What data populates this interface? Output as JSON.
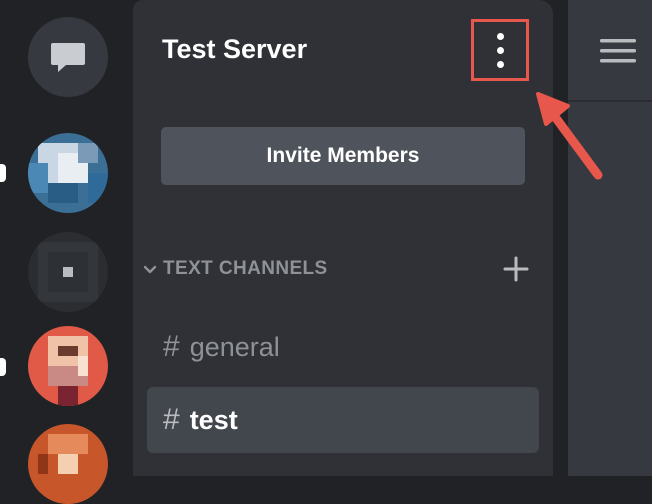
{
  "server": {
    "title": "Test Server",
    "menu_icon": "vertical-ellipsis-icon"
  },
  "invite_button": {
    "label": "Invite Members"
  },
  "category": {
    "label": "TEXT CHANNELS",
    "collapse_icon": "chevron-down-icon",
    "add_icon": "plus-icon"
  },
  "channels": [
    {
      "hash": "#",
      "name": "general",
      "selected": false
    },
    {
      "hash": "#",
      "name": "test",
      "selected": true
    }
  ],
  "guilds": {
    "dm_icon": "chat-bubble-icon",
    "items": [
      "pixelated-server-icon-1",
      "pixelated-server-icon-2",
      "pixelated-server-icon-3",
      "pixelated-server-icon-4"
    ]
  },
  "right_panel": {
    "menu_icon": "hamburger-icon"
  },
  "annotation": {
    "color": "#e8574b",
    "arrow_icon": "arrow-icon"
  },
  "colors": {
    "guild_bg": "#202225",
    "channel_bg": "#2f3136",
    "chat_bg": "#36393f",
    "selected_channel": "#42464d",
    "button": "#4f545c",
    "muted_text": "#8e9297"
  }
}
